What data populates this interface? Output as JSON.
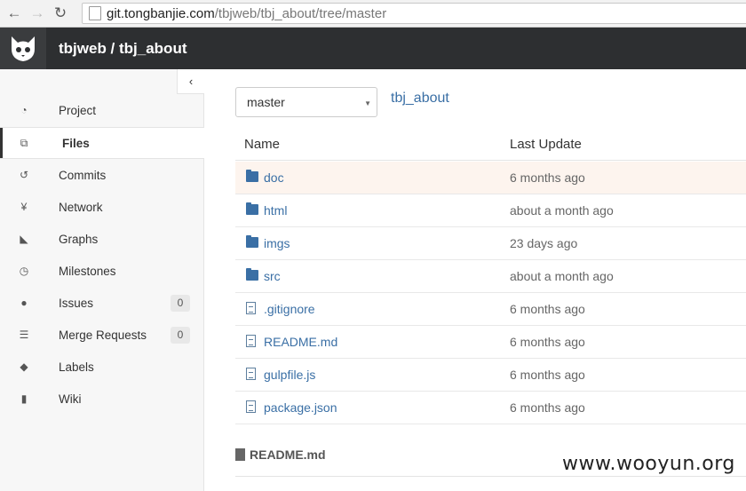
{
  "browser": {
    "url_domain": "git.tongbanjie.com",
    "url_path": "/tbjweb/tbj_about/tree/master"
  },
  "header": {
    "title": "tbjweb / tbj_about"
  },
  "sidebar": {
    "items": [
      {
        "label": "Project",
        "icon": "dashboard-icon"
      },
      {
        "label": "Files",
        "icon": "files-icon"
      },
      {
        "label": "Commits",
        "icon": "history-icon"
      },
      {
        "label": "Network",
        "icon": "code-fork-icon"
      },
      {
        "label": "Graphs",
        "icon": "area-chart-icon"
      },
      {
        "label": "Milestones",
        "icon": "clock-icon"
      },
      {
        "label": "Issues",
        "icon": "exclamation-circle-icon",
        "count": "0"
      },
      {
        "label": "Merge Requests",
        "icon": "tasks-icon",
        "count": "0"
      },
      {
        "label": "Labels",
        "icon": "tags-icon"
      },
      {
        "label": "Wiki",
        "icon": "book-icon"
      }
    ]
  },
  "main": {
    "branch": "master",
    "breadcrumb": "tbj_about",
    "columns": {
      "name": "Name",
      "last_update": "Last Update"
    },
    "files": [
      {
        "name": "doc",
        "type": "folder",
        "updated": "6 months ago"
      },
      {
        "name": "html",
        "type": "folder",
        "updated": "about a month ago"
      },
      {
        "name": "imgs",
        "type": "folder",
        "updated": "23 days ago"
      },
      {
        "name": "src",
        "type": "folder",
        "updated": "about a month ago"
      },
      {
        "name": ".gitignore",
        "type": "file",
        "updated": "6 months ago"
      },
      {
        "name": "README.md",
        "type": "file",
        "updated": "6 months ago"
      },
      {
        "name": "gulpfile.js",
        "type": "file",
        "updated": "6 months ago"
      },
      {
        "name": "package.json",
        "type": "file",
        "updated": "6 months ago"
      }
    ],
    "readme_title": "README.md"
  },
  "watermark": "www.wooyun.org",
  "colors": {
    "link": "#3a6fa5",
    "header_bg": "#2d2f31",
    "row_highlight": "#fdf4ee"
  }
}
